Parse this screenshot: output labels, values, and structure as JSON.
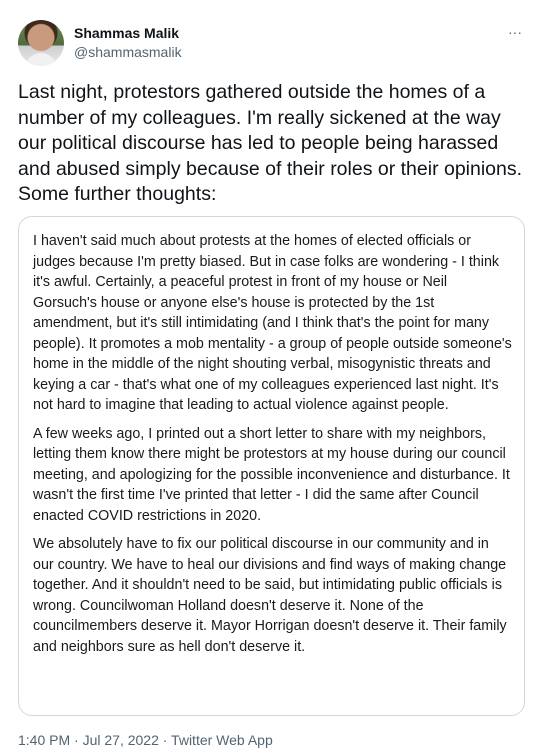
{
  "author": {
    "name": "Shammas Malik",
    "handle": "@shammasmalik"
  },
  "more_icon": "···",
  "tweet_text": "Last night, protestors gathered outside the homes of a number of my colleagues. I'm really sickened at the way our political discourse has led to people being harassed and abused simply because of their roles or their opinions. Some further thoughts:",
  "image_paragraphs": [
    "I haven't said much about protests at the homes of elected officials or judges because I'm pretty biased. But in case folks are wondering - I think it's awful. Certainly, a peaceful protest in front of my house or Neil Gorsuch's house or anyone else's house is protected by the 1st amendment, but it's still intimidating (and I think that's the point for many people). It promotes a mob mentality - a group of people outside someone's home in the middle of the night shouting verbal, misogynistic threats and keying a car - that's what one of my colleagues experienced last night. It's not hard to imagine that leading to actual violence against people.",
    "A few weeks ago, I printed out a short letter to share with my neighbors, letting them know there might be protestors at my house during our council meeting, and apologizing for the possible inconvenience and disturbance. It wasn't the first time I've printed that letter - I did the same after Council enacted COVID restrictions in 2020.",
    "We absolutely have to fix our political discourse in our community and in our country. We have to heal our divisions and find ways of making change together. And it shouldn't need to be said, but intimidating public officials is wrong.  Councilwoman Holland doesn't deserve it. None of the councilmembers deserve it. Mayor Horrigan doesn't deserve it. Their family and neighbors sure as hell don't deserve it."
  ],
  "meta": "1:40 PM · Jul 27, 2022 · Twitter Web App"
}
